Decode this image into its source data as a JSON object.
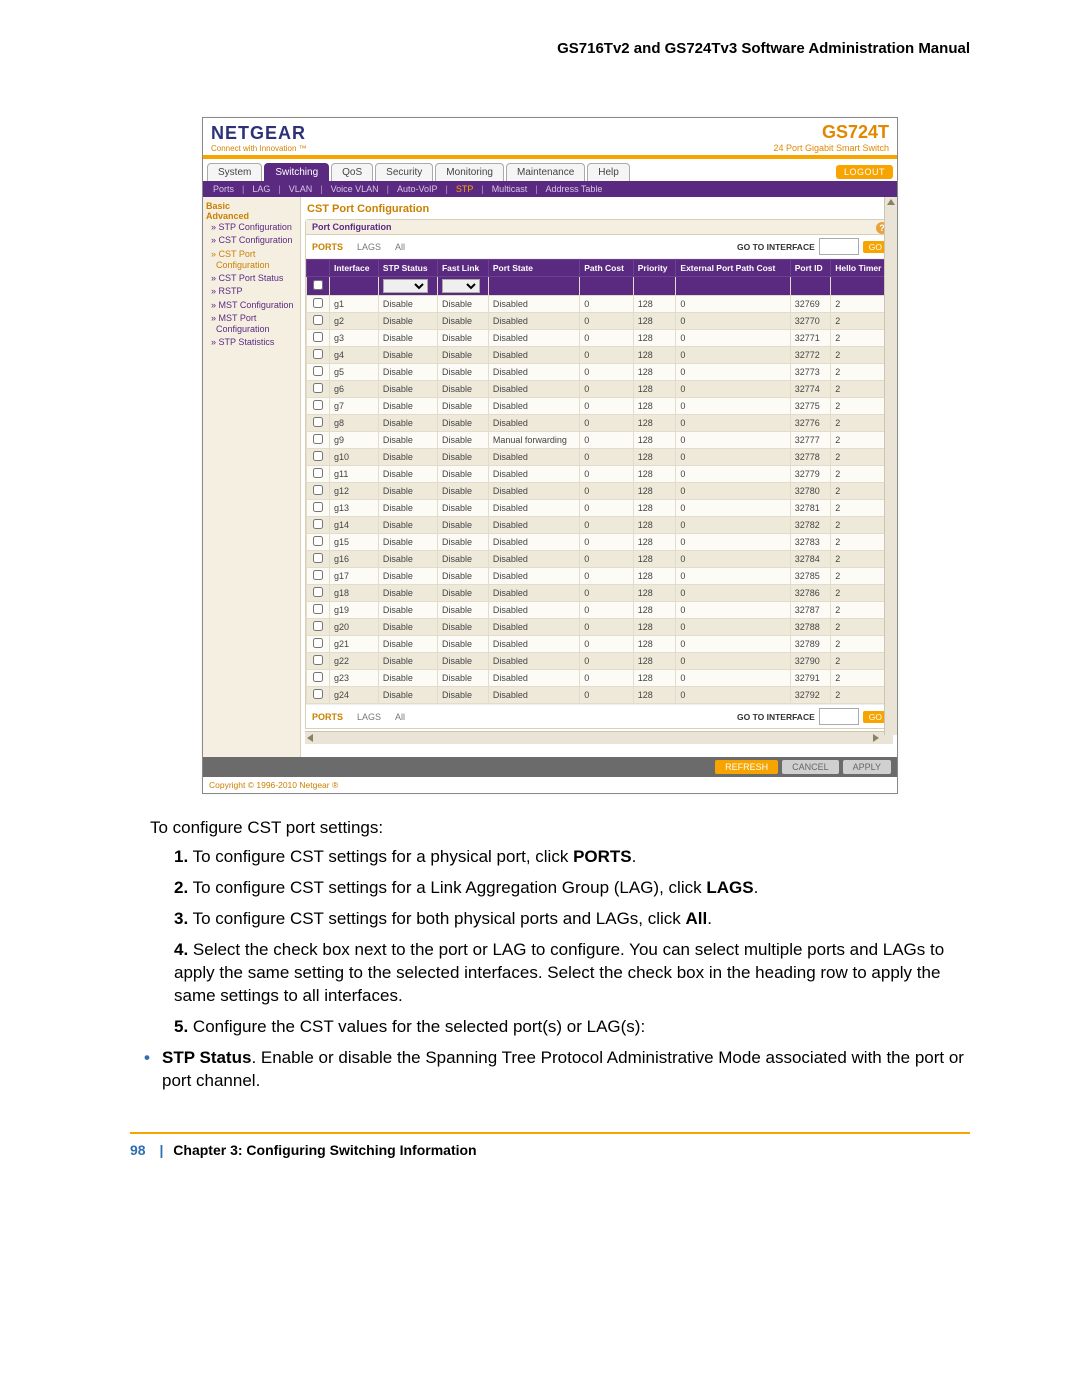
{
  "doc_title": "GS716Tv2 and GS724Tv3 Software Administration Manual",
  "brand": {
    "name": "NETGEAR",
    "tagline": "Connect with Innovation ™",
    "model": "GS724T",
    "subtitle": "24 Port Gigabit Smart Switch"
  },
  "logout": "LOGOUT",
  "tabs": [
    "System",
    "Switching",
    "QoS",
    "Security",
    "Monitoring",
    "Maintenance",
    "Help"
  ],
  "active_tab": "Switching",
  "subnav": [
    "Ports",
    "LAG",
    "VLAN",
    "Voice VLAN",
    "Auto-VoIP",
    "STP",
    "Multicast",
    "Address Table"
  ],
  "subnav_active": "STP",
  "sidebar": {
    "groups": [
      {
        "label": "Basic",
        "cls": "side-head"
      },
      {
        "label": "Advanced",
        "cls": "side-head"
      },
      {
        "label": "» STP Configuration",
        "cls": "side-item"
      },
      {
        "label": "» CST Configuration",
        "cls": "side-item"
      },
      {
        "label": "» CST Port Configuration",
        "cls": "side-item side-sel"
      },
      {
        "label": "» CST Port Status",
        "cls": "side-item"
      },
      {
        "label": "» RSTP",
        "cls": "side-item"
      },
      {
        "label": "» MST Configuration",
        "cls": "side-item"
      },
      {
        "label": "» MST Port Configuration",
        "cls": "side-item"
      },
      {
        "label": "» STP Statistics",
        "cls": "side-item"
      }
    ]
  },
  "section_title": "CST Port Configuration",
  "subsection_title": "Port Configuration",
  "filters": {
    "ports": "PORTS",
    "lags": "LAGS",
    "all": "All",
    "goto": "GO TO INTERFACE",
    "go": "GO"
  },
  "columns": [
    "",
    "Interface",
    "STP Status",
    "Fast Link",
    "Port State",
    "Path Cost",
    "Priority",
    "External Port Path Cost",
    "Port ID",
    "Hello Timer"
  ],
  "rows": [
    {
      "if": "g1",
      "stp": "Disable",
      "fl": "Disable",
      "ps": "Disabled",
      "pc": "0",
      "pr": "128",
      "ep": "0",
      "pid": "32769",
      "ht": "2"
    },
    {
      "if": "g2",
      "stp": "Disable",
      "fl": "Disable",
      "ps": "Disabled",
      "pc": "0",
      "pr": "128",
      "ep": "0",
      "pid": "32770",
      "ht": "2"
    },
    {
      "if": "g3",
      "stp": "Disable",
      "fl": "Disable",
      "ps": "Disabled",
      "pc": "0",
      "pr": "128",
      "ep": "0",
      "pid": "32771",
      "ht": "2"
    },
    {
      "if": "g4",
      "stp": "Disable",
      "fl": "Disable",
      "ps": "Disabled",
      "pc": "0",
      "pr": "128",
      "ep": "0",
      "pid": "32772",
      "ht": "2"
    },
    {
      "if": "g5",
      "stp": "Disable",
      "fl": "Disable",
      "ps": "Disabled",
      "pc": "0",
      "pr": "128",
      "ep": "0",
      "pid": "32773",
      "ht": "2"
    },
    {
      "if": "g6",
      "stp": "Disable",
      "fl": "Disable",
      "ps": "Disabled",
      "pc": "0",
      "pr": "128",
      "ep": "0",
      "pid": "32774",
      "ht": "2"
    },
    {
      "if": "g7",
      "stp": "Disable",
      "fl": "Disable",
      "ps": "Disabled",
      "pc": "0",
      "pr": "128",
      "ep": "0",
      "pid": "32775",
      "ht": "2"
    },
    {
      "if": "g8",
      "stp": "Disable",
      "fl": "Disable",
      "ps": "Disabled",
      "pc": "0",
      "pr": "128",
      "ep": "0",
      "pid": "32776",
      "ht": "2"
    },
    {
      "if": "g9",
      "stp": "Disable",
      "fl": "Disable",
      "ps": "Manual forwarding",
      "pc": "0",
      "pr": "128",
      "ep": "0",
      "pid": "32777",
      "ht": "2"
    },
    {
      "if": "g10",
      "stp": "Disable",
      "fl": "Disable",
      "ps": "Disabled",
      "pc": "0",
      "pr": "128",
      "ep": "0",
      "pid": "32778",
      "ht": "2"
    },
    {
      "if": "g11",
      "stp": "Disable",
      "fl": "Disable",
      "ps": "Disabled",
      "pc": "0",
      "pr": "128",
      "ep": "0",
      "pid": "32779",
      "ht": "2"
    },
    {
      "if": "g12",
      "stp": "Disable",
      "fl": "Disable",
      "ps": "Disabled",
      "pc": "0",
      "pr": "128",
      "ep": "0",
      "pid": "32780",
      "ht": "2"
    },
    {
      "if": "g13",
      "stp": "Disable",
      "fl": "Disable",
      "ps": "Disabled",
      "pc": "0",
      "pr": "128",
      "ep": "0",
      "pid": "32781",
      "ht": "2"
    },
    {
      "if": "g14",
      "stp": "Disable",
      "fl": "Disable",
      "ps": "Disabled",
      "pc": "0",
      "pr": "128",
      "ep": "0",
      "pid": "32782",
      "ht": "2"
    },
    {
      "if": "g15",
      "stp": "Disable",
      "fl": "Disable",
      "ps": "Disabled",
      "pc": "0",
      "pr": "128",
      "ep": "0",
      "pid": "32783",
      "ht": "2"
    },
    {
      "if": "g16",
      "stp": "Disable",
      "fl": "Disable",
      "ps": "Disabled",
      "pc": "0",
      "pr": "128",
      "ep": "0",
      "pid": "32784",
      "ht": "2"
    },
    {
      "if": "g17",
      "stp": "Disable",
      "fl": "Disable",
      "ps": "Disabled",
      "pc": "0",
      "pr": "128",
      "ep": "0",
      "pid": "32785",
      "ht": "2"
    },
    {
      "if": "g18",
      "stp": "Disable",
      "fl": "Disable",
      "ps": "Disabled",
      "pc": "0",
      "pr": "128",
      "ep": "0",
      "pid": "32786",
      "ht": "2"
    },
    {
      "if": "g19",
      "stp": "Disable",
      "fl": "Disable",
      "ps": "Disabled",
      "pc": "0",
      "pr": "128",
      "ep": "0",
      "pid": "32787",
      "ht": "2"
    },
    {
      "if": "g20",
      "stp": "Disable",
      "fl": "Disable",
      "ps": "Disabled",
      "pc": "0",
      "pr": "128",
      "ep": "0",
      "pid": "32788",
      "ht": "2"
    },
    {
      "if": "g21",
      "stp": "Disable",
      "fl": "Disable",
      "ps": "Disabled",
      "pc": "0",
      "pr": "128",
      "ep": "0",
      "pid": "32789",
      "ht": "2"
    },
    {
      "if": "g22",
      "stp": "Disable",
      "fl": "Disable",
      "ps": "Disabled",
      "pc": "0",
      "pr": "128",
      "ep": "0",
      "pid": "32790",
      "ht": "2"
    },
    {
      "if": "g23",
      "stp": "Disable",
      "fl": "Disable",
      "ps": "Disabled",
      "pc": "0",
      "pr": "128",
      "ep": "0",
      "pid": "32791",
      "ht": "2"
    },
    {
      "if": "g24",
      "stp": "Disable",
      "fl": "Disable",
      "ps": "Disabled",
      "pc": "0",
      "pr": "128",
      "ep": "0",
      "pid": "32792",
      "ht": "2"
    }
  ],
  "actions": {
    "refresh": "REFRESH",
    "cancel": "CANCEL",
    "apply": "APPLY"
  },
  "copyright": "Copyright © 1996-2010 Netgear ®",
  "instr_lead": "To configure CST port settings:",
  "steps": [
    "To configure CST settings for a physical port, click <b>PORTS</b>.",
    "To configure CST settings for a Link Aggregation Group (LAG), click <b>LAGS</b>.",
    "To configure CST settings for both physical ports and LAGs, click <b>All</b>.",
    "Select the check box next to the port or LAG to configure. You can select multiple ports and LAGs to apply the same setting to the selected interfaces. Select the check box in the heading row to apply the same settings to all interfaces.",
    "Configure the CST values for the selected port(s) or LAG(s):"
  ],
  "bullet": "<b>STP Status</b>. Enable or disable the Spanning Tree Protocol Administrative Mode associated with the port or port channel.",
  "footer": {
    "page": "98",
    "chapter": "Chapter 3:  Configuring Switching Information"
  }
}
